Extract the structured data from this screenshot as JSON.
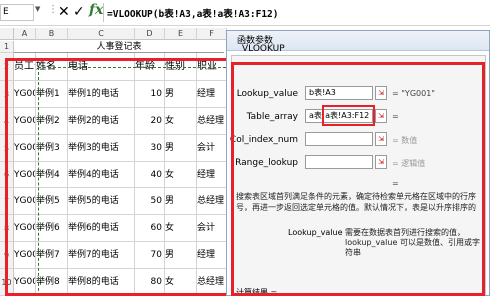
{
  "formula_bar": {
    "name_box": "E",
    "dots": "⋮",
    "cancel": "✕",
    "enter": "✓",
    "fx": "fx",
    "formula": "=VLOOKUP(b表!A3,a表!a表!A3:F12)"
  },
  "columns": [
    "A",
    "B",
    "C",
    "D",
    "E",
    "F"
  ],
  "rows": [
    "1",
    "2",
    "3",
    "4",
    "5",
    "6",
    "7",
    "8",
    "9",
    "10",
    "11"
  ],
  "sheet": {
    "title": "人事登记表",
    "headers": [
      "员工号",
      "姓名",
      "电话",
      "年龄",
      "性别",
      "职业"
    ],
    "records": [
      [
        "YG001",
        "举例1",
        "举例1的电话",
        "10",
        "男",
        "经理"
      ],
      [
        "YG002",
        "举例2",
        "举例2的电话",
        "20",
        "女",
        "总经理"
      ],
      [
        "YG003",
        "举例3",
        "举例3的电话",
        "30",
        "男",
        "会计"
      ],
      [
        "YG004",
        "举例4",
        "举例4的电话",
        "40",
        "女",
        "经理"
      ],
      [
        "YG005",
        "举例5",
        "举例5的电话",
        "50",
        "男",
        "总经理"
      ],
      [
        "YG006",
        "举例6",
        "举例6的电话",
        "60",
        "女",
        "会计"
      ],
      [
        "YG007",
        "举例7",
        "举例7的电话",
        "70",
        "男",
        "经理"
      ],
      [
        "YG008",
        "举例8",
        "举例8的电话",
        "80",
        "女",
        "总经理"
      ]
    ]
  },
  "dialog": {
    "title": "函数参数",
    "group": "VLOOKUP",
    "args": [
      {
        "label": "Lookup_value",
        "value": "b表!A3",
        "result": "= \"YG001\"",
        "muted": false
      },
      {
        "label": "Table_array",
        "value": "a表!a表!A3:F12",
        "result": "=",
        "muted": false
      },
      {
        "label": "Col_index_num",
        "value": "",
        "result": "= 数值",
        "muted": true
      },
      {
        "label": "Range_lookup",
        "value": "",
        "result": "= 逻辑值",
        "muted": true
      }
    ],
    "eq_mid": "=",
    "description": "搜索表区域首列满足条件的元素，确定待检索单元格在区域中的行序号，再进一步返回选定单元格的值。默认情况下，表是以升序排序的",
    "arg_help_name": "Lookup_value",
    "arg_help_text": "需要在数据表首列进行搜索的值，lookup_value 可以是数值、引用或字符串",
    "calc_result": "计算结果 ="
  }
}
